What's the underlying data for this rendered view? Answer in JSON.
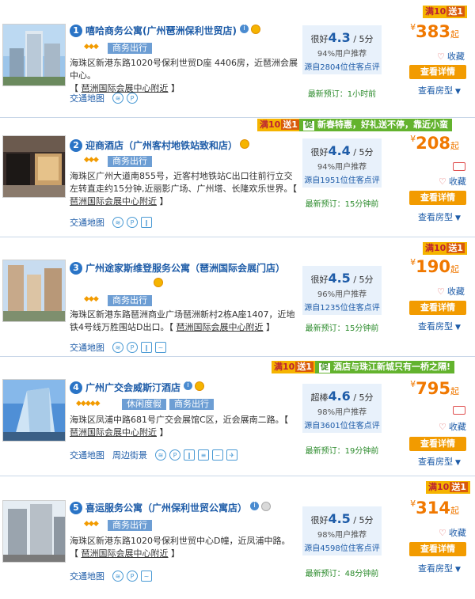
{
  "labels": {
    "traffic_map": "交通地图",
    "surroundings": "周边街景",
    "favorite": "收藏",
    "view_detail": "查看详情",
    "view_rooms": "查看房型",
    "currency": "¥",
    "price_unit": "起",
    "score_suffix": "/ 5分",
    "promo_full": "满10",
    "promo_gift": "送1",
    "biz_tag": "商务出行",
    "leisure_tag": "休闲度假",
    "promo_icon": "促"
  },
  "hotels": [
    {
      "rank": "1",
      "name": "嘻哈商务公寓(广州琶洲保利世贸店)",
      "stars": "◆◆◆",
      "address": "海珠区新港东路1020号保利世贸D座 4406房，近琶洲会展中心。",
      "near": "琶洲国际会展中心附近",
      "score_label": "很好",
      "score": "4.3",
      "recommend": "94%用户推荐",
      "reviews": "源自2804位住客点评",
      "booked": "最新预订：1小时前",
      "price": "383"
    },
    {
      "rank": "2",
      "name": "迎商酒店（广州客村地铁站致和店）",
      "stars": "◆◆◆",
      "address": "海珠区广州大道南855号，近客村地铁站C出口往前行立交左转直走约15分钟,近丽影广场、广州塔、长隆欢乐世界。【",
      "near": "琶洲国际会展中心附近",
      "promo": "新春特惠，好礼送不停，靠近小蛮",
      "score_label": "很好",
      "score": "4.4",
      "recommend": "94%用户推荐",
      "reviews": "源自1951位住客点评",
      "booked": "最新预订：15分钟前",
      "price": "208"
    },
    {
      "rank": "3",
      "name": "广州途家斯维登服务公寓（琶洲国际会展门店）",
      "stars": "◆◆◆",
      "address": "海珠区新港东路琶洲商业广场琶洲新村2栋A座1407，近地铁4号线万胜围站D出口。【",
      "near": "琶洲国际会展中心附近",
      "score_label": "很好",
      "score": "4.5",
      "recommend": "96%用户推荐",
      "reviews": "源自1235位住客点评",
      "booked": "最新预订：15分钟前",
      "price": "190"
    },
    {
      "rank": "4",
      "name": "广州广交会威斯汀酒店",
      "stars": "◆◆◆◆◆",
      "address": "海珠区凤浦中路681号广交会展馆C区，近会展南二路。【",
      "near": "琶洲国际会展中心附近",
      "promo": "酒店与珠江新城只有一桥之隔!",
      "score_label": "超棒",
      "score": "4.6",
      "recommend": "98%用户推荐",
      "reviews": "源自3601位住客点评",
      "booked": "最新预订：19分钟前",
      "price": "795"
    },
    {
      "rank": "5",
      "name": "喜运服务公寓（广州保利世贸公寓店）",
      "stars": "◆◆◆",
      "address": "海珠区新港东路1020号保利世贸中心D幢，近凤浦中路。",
      "near": "琶洲国际会展中心附近",
      "score_label": "很好",
      "score": "4.5",
      "recommend": "98%用户推荐",
      "reviews": "源自4598位住客点评",
      "booked": "最新预订：48分钟前",
      "price": "314"
    }
  ]
}
